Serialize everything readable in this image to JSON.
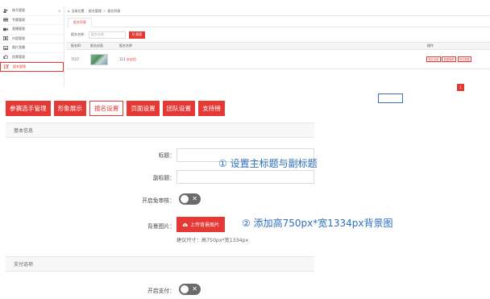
{
  "admin": {
    "sidebar": [
      {
        "label": "账号管理",
        "icon": "user-group-icon",
        "chevron": "∨"
      },
      {
        "label": "专题管理",
        "icon": "list-icon"
      },
      {
        "label": "直播管理",
        "icon": "video-icon"
      },
      {
        "label": "内容管理",
        "icon": "film-icon"
      },
      {
        "label": "图片直播",
        "icon": "image-icon"
      },
      {
        "label": "投票管理",
        "icon": "thumb-icon"
      },
      {
        "label": "报名管理",
        "icon": "edit-icon"
      }
    ],
    "breadcrumb": {
      "home_label": "当前位置",
      "level1": "报名管理",
      "level2": "报名列表"
    },
    "active_tab": "报名列表",
    "filter": {
      "label": "报名名称：",
      "placeholder": "报名名称",
      "search_label": "Q 搜索"
    },
    "table": {
      "headers": {
        "id": "报名ID",
        "image": "报名封面",
        "name": "报名名称",
        "ops": "操作"
      },
      "rows": [
        {
          "id": "7157",
          "name_prefix": "111",
          "name_tag": "未启用",
          "ops": [
            "报名设置",
            "数据管理",
            "报名数据"
          ]
        }
      ]
    },
    "page_chip": "1"
  },
  "tabs": [
    {
      "label": "参赛选手管理",
      "active": false
    },
    {
      "label": "形象展示",
      "active": false
    },
    {
      "label": "报名设置",
      "active": true
    },
    {
      "label": "页面设置",
      "active": false
    },
    {
      "label": "团队设置",
      "active": false
    },
    {
      "label": "支持榜",
      "active": false
    }
  ],
  "form": {
    "basic_section": "基本信息",
    "title_label": "标题：",
    "subtitle_label": "副标题：",
    "review_label": "开启免审核：",
    "bg_label": "背景图片：",
    "upload_label": "上传背景图片",
    "bg_hint": "建议尺寸：高750px*宽1334px",
    "pay_section": "支付选项",
    "pay_label": "开启支付："
  },
  "annotations": {
    "step1": "① 设置主标题与副标题",
    "step2": "② 添加高750px*宽1334px背景图"
  },
  "colors": {
    "accent": "#e53935",
    "annotation": "#2d6fbd",
    "toggle_off": "#6b6b6b"
  }
}
